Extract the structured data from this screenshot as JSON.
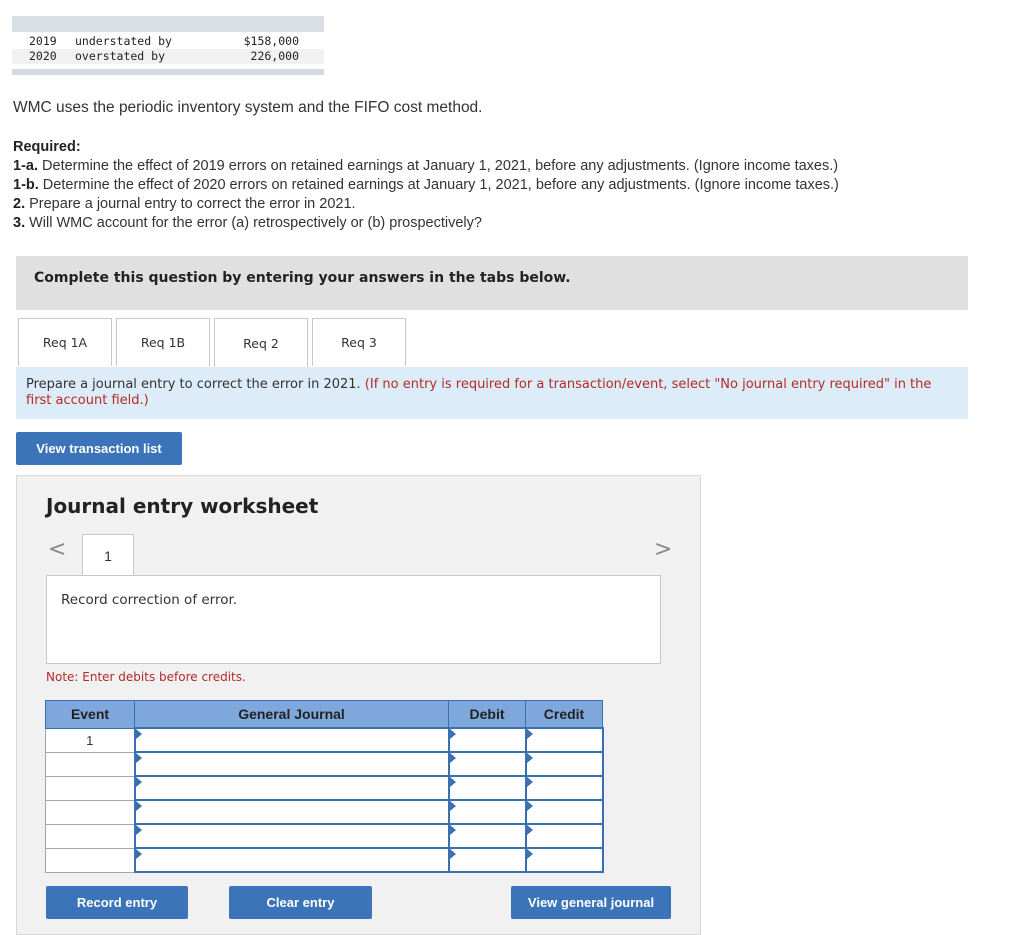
{
  "error_table": {
    "rows": [
      {
        "year": "2019",
        "desc": "understated by",
        "amount": "$158,000"
      },
      {
        "year": "2020",
        "desc": "overstated by",
        "amount": "226,000"
      }
    ]
  },
  "intro": "WMC uses the periodic inventory system and the FIFO cost method.",
  "required": {
    "heading": "Required:",
    "items": [
      {
        "num": "1-a.",
        "text": " Determine the effect of 2019 errors on retained earnings at January 1, 2021, before any adjustments. (Ignore income taxes.)"
      },
      {
        "num": "1-b.",
        "text": " Determine the effect of 2020 errors on retained earnings at January 1, 2021, before any adjustments. (Ignore income taxes.)"
      },
      {
        "num": "2.",
        "text": " Prepare a journal entry to correct the error in 2021."
      },
      {
        "num": "3.",
        "text": " Will WMC account for the error (a) retrospectively or (b) prospectively?"
      }
    ]
  },
  "panel_heading": "Complete this question by entering your answers in the tabs below.",
  "tabs": [
    "Req 1A",
    "Req 1B",
    "Req 2",
    "Req 3"
  ],
  "active_tab": "Req 2",
  "instruction": {
    "main": "Prepare a journal entry to correct the error in 2021. ",
    "note": "(If no entry is required for a transaction/event, select \"No journal entry required\" in the first account field.)"
  },
  "view_transaction_list": "View transaction list",
  "worksheet": {
    "title": "Journal entry worksheet",
    "prev_icon": "<",
    "next_icon": ">",
    "page": "1",
    "description": "Record correction of error.",
    "note": "Note: Enter debits before credits."
  },
  "journal_table": {
    "headers": [
      "Event",
      "General Journal",
      "Debit",
      "Credit"
    ],
    "rows": [
      {
        "event": "1"
      },
      {
        "event": ""
      },
      {
        "event": ""
      },
      {
        "event": ""
      },
      {
        "event": ""
      },
      {
        "event": ""
      }
    ]
  },
  "buttons": {
    "record": "Record entry",
    "clear": "Clear entry",
    "view_journal": "View general journal"
  }
}
